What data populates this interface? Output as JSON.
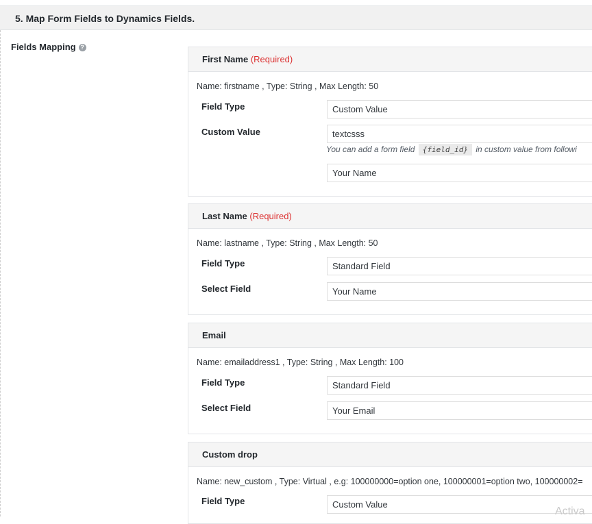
{
  "section": {
    "title": "5. Map Form Fields to Dynamics Fields."
  },
  "fields_mapping": {
    "label": "Fields Mapping",
    "help_glyph": "?"
  },
  "cards": [
    {
      "title": "First Name",
      "required": "(Required)",
      "meta": "Name: firstname , Type: String , Max Length: 50",
      "field_type_label": "Field Type",
      "field_type_value": "Custom Value",
      "second_label": "Custom Value",
      "second_value": "textcsss",
      "hint_pre": "You can add a form field",
      "hint_code": "{field_id}",
      "hint_post": "in custom value from followi",
      "extra_select": "Your Name"
    },
    {
      "title": "Last Name",
      "required": "(Required)",
      "meta": "Name: lastname , Type: String , Max Length: 50",
      "field_type_label": "Field Type",
      "field_type_value": "Standard Field",
      "second_label": "Select Field",
      "second_value": "Your Name"
    },
    {
      "title": "Email",
      "meta": "Name: emailaddress1 , Type: String , Max Length: 100",
      "field_type_label": "Field Type",
      "field_type_value": "Standard Field",
      "second_label": "Select Field",
      "second_value": "Your Email"
    },
    {
      "title": "Custom drop",
      "meta": "Name: new_custom , Type: Virtual , e.g: 100000000=option one, 100000001=option two, 100000002=",
      "field_type_label": "Field Type",
      "field_type_value": "Custom Value"
    }
  ],
  "watermark": "Activa"
}
